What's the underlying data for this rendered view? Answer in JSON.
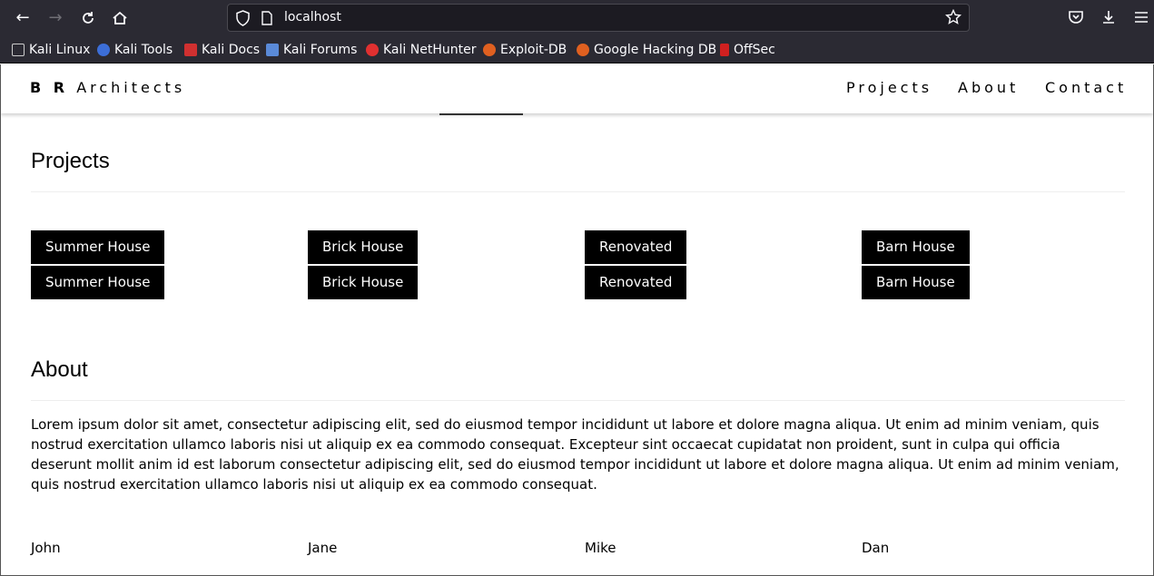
{
  "browser": {
    "url": "localhost",
    "bookmarks": [
      {
        "label": "Kali Linux",
        "icon": "kali-linux-icon",
        "color": "#cccccc"
      },
      {
        "label": "Kali Tools",
        "icon": "kali-tools-icon",
        "color": "#3c6ed8"
      },
      {
        "label": "Kali Docs",
        "icon": "kali-docs-icon",
        "color": "#d03030"
      },
      {
        "label": "Kali Forums",
        "icon": "kali-forums-icon",
        "color": "#5a8ad8"
      },
      {
        "label": "Kali NetHunter",
        "icon": "kali-nethunter-icon",
        "color": "#e03030"
      },
      {
        "label": "Exploit-DB",
        "icon": "exploit-db-icon",
        "color": "#e06020"
      },
      {
        "label": "Google Hacking DB",
        "icon": "google-hacking-db-icon",
        "color": "#e06020"
      },
      {
        "label": "OffSec",
        "icon": "offsec-icon",
        "color": "#d02020"
      }
    ]
  },
  "site": {
    "brand_bold": "B R",
    "brand_rest": "Architects",
    "nav": [
      "Projects",
      "About",
      "Contact"
    ]
  },
  "projects": {
    "title": "Projects",
    "rows": [
      [
        "Summer House",
        "Brick House",
        "Renovated",
        "Barn House"
      ],
      [
        "Summer House",
        "Brick House",
        "Renovated",
        "Barn House"
      ]
    ]
  },
  "about": {
    "title": "About",
    "text": "Lorem ipsum dolor sit amet, consectetur adipiscing elit, sed do eiusmod tempor incididunt ut labore et dolore magna aliqua. Ut enim ad minim veniam, quis nostrud exercitation ullamco laboris nisi ut aliquip ex ea commodo consequat. Excepteur sint occaecat cupidatat non proident, sunt in culpa qui officia deserunt mollit anim id est laborum consectetur adipiscing elit, sed do eiusmod tempor incididunt ut labore et dolore magna aliqua. Ut enim ad minim veniam, quis nostrud exercitation ullamco laboris nisi ut aliquip ex ea commodo consequat.",
    "team": [
      "John",
      "Jane",
      "Mike",
      "Dan"
    ]
  }
}
